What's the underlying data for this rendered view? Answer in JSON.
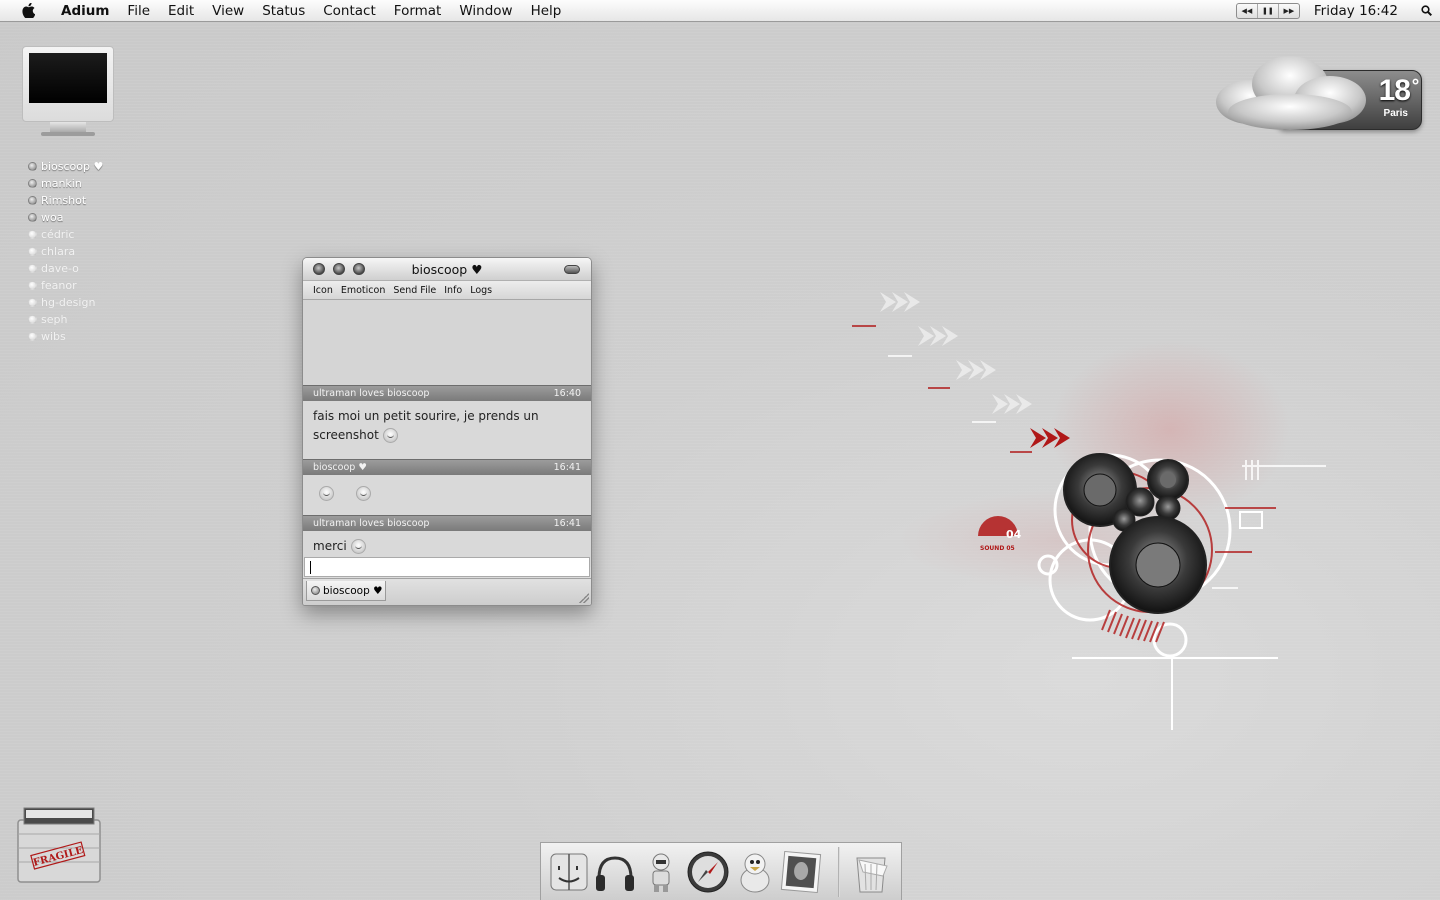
{
  "menubar": {
    "app": "Adium",
    "items": [
      "File",
      "Edit",
      "View",
      "Status",
      "Contact",
      "Format",
      "Window",
      "Help"
    ],
    "clock": "Friday 16:42",
    "media_controls": [
      "rewind-icon",
      "pause-icon",
      "fast-forward-icon"
    ]
  },
  "contacts": [
    {
      "name": "bioscoop ♥",
      "status": "online"
    },
    {
      "name": "mankin",
      "status": "online"
    },
    {
      "name": "Rimshot",
      "status": "online"
    },
    {
      "name": "woa",
      "status": "online"
    },
    {
      "name": "cédric",
      "status": "offline"
    },
    {
      "name": "chlara",
      "status": "offline"
    },
    {
      "name": "dave-o",
      "status": "offline"
    },
    {
      "name": "feanor",
      "status": "offline"
    },
    {
      "name": "hg-design",
      "status": "offline"
    },
    {
      "name": "seph",
      "status": "offline"
    },
    {
      "name": "wibs",
      "status": "offline"
    }
  ],
  "chat": {
    "title": "bioscoop ♥",
    "toolbar": [
      "Icon",
      "Emoticon",
      "Send File",
      "Info",
      "Logs"
    ],
    "messages": [
      {
        "sender": "ultraman loves bioscoop",
        "time": "16:40",
        "text": "fais moi un petit sourire, je prends un screenshot"
      },
      {
        "sender": "bioscoop ♥",
        "time": "16:41",
        "text": ""
      },
      {
        "sender": "ultraman loves bioscoop",
        "time": "16:41",
        "text": "merci"
      }
    ],
    "input_value": "",
    "tab_label": "bioscoop ♥"
  },
  "weather": {
    "temp": "18",
    "degree": "°",
    "city": "Paris"
  },
  "art": {
    "number": "04",
    "label": "SOUND 05"
  },
  "fragile_label": "FRAGILE",
  "dock": [
    "finder-icon",
    "headphones-icon",
    "robot-icon",
    "safari-icon",
    "adium-duck-icon",
    "photo-icon",
    "trash-icon"
  ],
  "colors": {
    "accent": "#b01818",
    "menubar": "#eeeeee",
    "desktop": "#cfcfcf"
  }
}
